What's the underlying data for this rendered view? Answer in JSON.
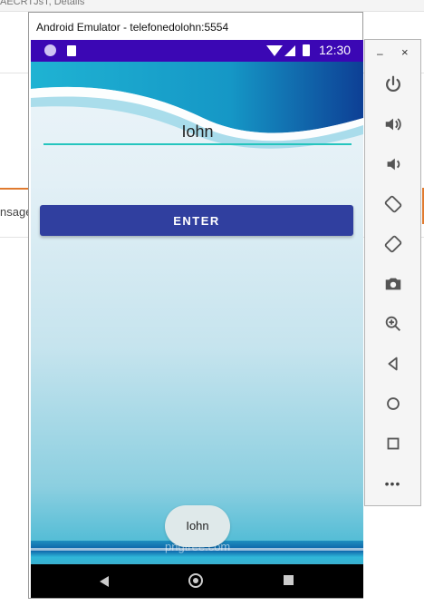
{
  "background": {
    "top_text": "AECRTJsT, Details",
    "side_text": "nsage"
  },
  "window": {
    "title": "Android Emulator - telefonedolohn:5554"
  },
  "statusbar": {
    "time": "12:30"
  },
  "form": {
    "name_value": "Iohn",
    "enter_label": "ENTER"
  },
  "toast": {
    "message": "Iohn"
  },
  "watermark": "pngtree.com",
  "controls": {
    "minimize": "–",
    "close": "×",
    "more": "•••"
  },
  "colors": {
    "statusbar": "#3b07b4",
    "accent": "#25c5be",
    "button": "#303f9f"
  }
}
